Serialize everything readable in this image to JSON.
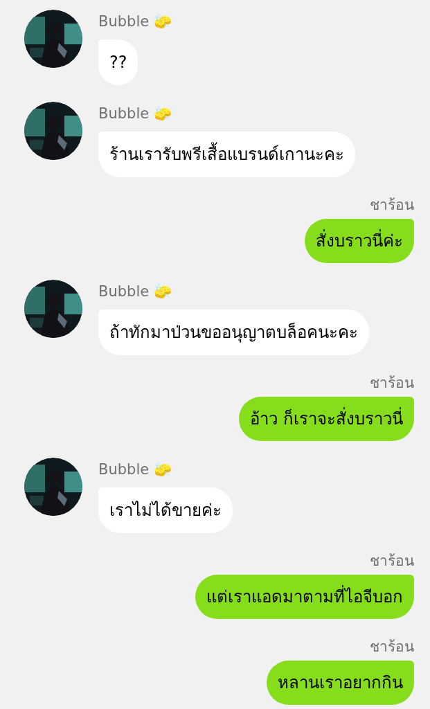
{
  "messages": [
    {
      "kind": "received",
      "sender": "Bubble 🧽",
      "text": "??"
    },
    {
      "kind": "received",
      "sender": "Bubble 🧽",
      "text": "ร้านเรารับพรีเสื้อแบรนด์เกานะคะ"
    },
    {
      "kind": "sent",
      "sender": "ชาร้อน",
      "text": "สั่งบราวนี่ค่ะ"
    },
    {
      "kind": "received",
      "sender": "Bubble 🧽",
      "text": "ถ้าทักมาป่วนขออนุญาตบล็อคนะคะ"
    },
    {
      "kind": "sent",
      "sender": "ชาร้อน",
      "text": "อ้าว ก็เราจะสั่งบราวนี่"
    },
    {
      "kind": "received",
      "sender": "Bubble 🧽",
      "text": "เราไม่ได้ขายค่ะ"
    },
    {
      "kind": "sent",
      "sender": "ชาร้อน",
      "text": "แต่เราแอดมาตามที่ไอจีบอก"
    },
    {
      "kind": "sent",
      "sender": "ชาร้อน",
      "text": "หลานเราอยากกิน"
    }
  ]
}
